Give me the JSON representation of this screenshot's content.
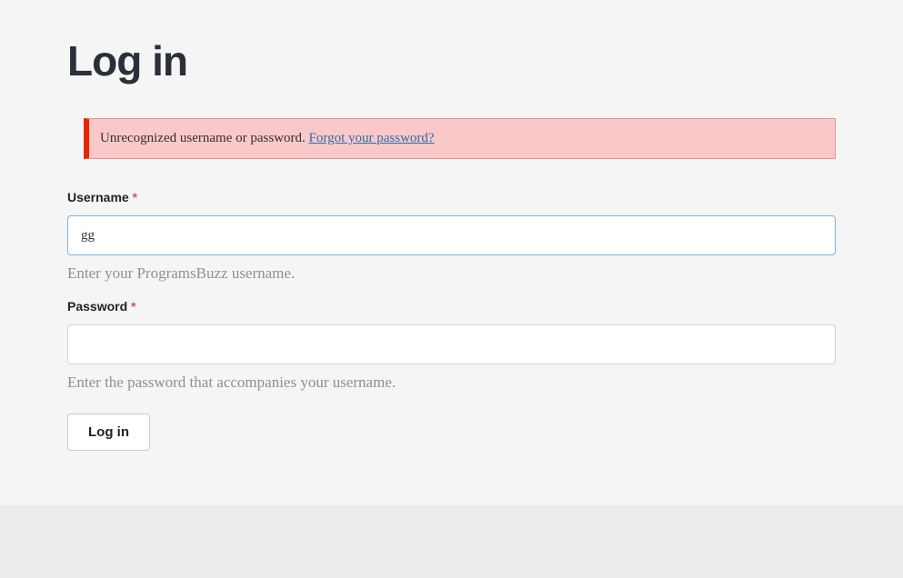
{
  "title": "Log in",
  "alert": {
    "message": "Unrecognized username or password. ",
    "link_text": "Forgot your password?"
  },
  "fields": {
    "username": {
      "label": "Username",
      "required_mark": "*",
      "value": "gg",
      "help": "Enter your ProgramsBuzz username."
    },
    "password": {
      "label": "Password",
      "required_mark": "*",
      "value": "",
      "help": "Enter the password that accompanies your username."
    }
  },
  "submit": {
    "label": "Log in"
  }
}
